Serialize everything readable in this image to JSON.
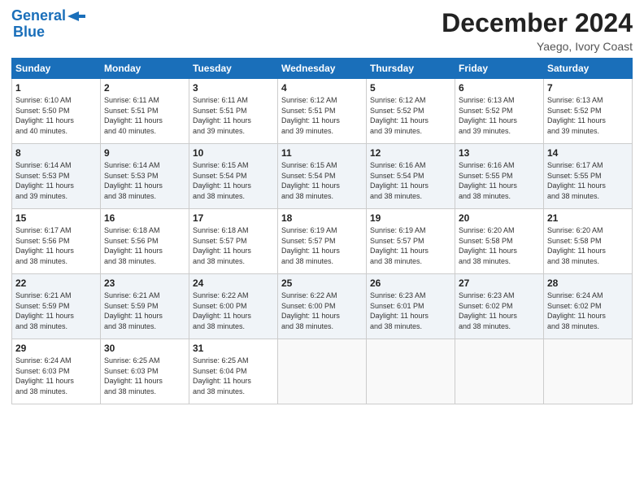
{
  "header": {
    "logo_line1": "General",
    "logo_line2": "Blue",
    "month": "December 2024",
    "location": "Yaego, Ivory Coast"
  },
  "weekdays": [
    "Sunday",
    "Monday",
    "Tuesday",
    "Wednesday",
    "Thursday",
    "Friday",
    "Saturday"
  ],
  "weeks": [
    [
      {
        "day": "1",
        "info": "Sunrise: 6:10 AM\nSunset: 5:50 PM\nDaylight: 11 hours\nand 40 minutes."
      },
      {
        "day": "2",
        "info": "Sunrise: 6:11 AM\nSunset: 5:51 PM\nDaylight: 11 hours\nand 40 minutes."
      },
      {
        "day": "3",
        "info": "Sunrise: 6:11 AM\nSunset: 5:51 PM\nDaylight: 11 hours\nand 39 minutes."
      },
      {
        "day": "4",
        "info": "Sunrise: 6:12 AM\nSunset: 5:51 PM\nDaylight: 11 hours\nand 39 minutes."
      },
      {
        "day": "5",
        "info": "Sunrise: 6:12 AM\nSunset: 5:52 PM\nDaylight: 11 hours\nand 39 minutes."
      },
      {
        "day": "6",
        "info": "Sunrise: 6:13 AM\nSunset: 5:52 PM\nDaylight: 11 hours\nand 39 minutes."
      },
      {
        "day": "7",
        "info": "Sunrise: 6:13 AM\nSunset: 5:52 PM\nDaylight: 11 hours\nand 39 minutes."
      }
    ],
    [
      {
        "day": "8",
        "info": "Sunrise: 6:14 AM\nSunset: 5:53 PM\nDaylight: 11 hours\nand 39 minutes."
      },
      {
        "day": "9",
        "info": "Sunrise: 6:14 AM\nSunset: 5:53 PM\nDaylight: 11 hours\nand 38 minutes."
      },
      {
        "day": "10",
        "info": "Sunrise: 6:15 AM\nSunset: 5:54 PM\nDaylight: 11 hours\nand 38 minutes."
      },
      {
        "day": "11",
        "info": "Sunrise: 6:15 AM\nSunset: 5:54 PM\nDaylight: 11 hours\nand 38 minutes."
      },
      {
        "day": "12",
        "info": "Sunrise: 6:16 AM\nSunset: 5:54 PM\nDaylight: 11 hours\nand 38 minutes."
      },
      {
        "day": "13",
        "info": "Sunrise: 6:16 AM\nSunset: 5:55 PM\nDaylight: 11 hours\nand 38 minutes."
      },
      {
        "day": "14",
        "info": "Sunrise: 6:17 AM\nSunset: 5:55 PM\nDaylight: 11 hours\nand 38 minutes."
      }
    ],
    [
      {
        "day": "15",
        "info": "Sunrise: 6:17 AM\nSunset: 5:56 PM\nDaylight: 11 hours\nand 38 minutes."
      },
      {
        "day": "16",
        "info": "Sunrise: 6:18 AM\nSunset: 5:56 PM\nDaylight: 11 hours\nand 38 minutes."
      },
      {
        "day": "17",
        "info": "Sunrise: 6:18 AM\nSunset: 5:57 PM\nDaylight: 11 hours\nand 38 minutes."
      },
      {
        "day": "18",
        "info": "Sunrise: 6:19 AM\nSunset: 5:57 PM\nDaylight: 11 hours\nand 38 minutes."
      },
      {
        "day": "19",
        "info": "Sunrise: 6:19 AM\nSunset: 5:57 PM\nDaylight: 11 hours\nand 38 minutes."
      },
      {
        "day": "20",
        "info": "Sunrise: 6:20 AM\nSunset: 5:58 PM\nDaylight: 11 hours\nand 38 minutes."
      },
      {
        "day": "21",
        "info": "Sunrise: 6:20 AM\nSunset: 5:58 PM\nDaylight: 11 hours\nand 38 minutes."
      }
    ],
    [
      {
        "day": "22",
        "info": "Sunrise: 6:21 AM\nSunset: 5:59 PM\nDaylight: 11 hours\nand 38 minutes."
      },
      {
        "day": "23",
        "info": "Sunrise: 6:21 AM\nSunset: 5:59 PM\nDaylight: 11 hours\nand 38 minutes."
      },
      {
        "day": "24",
        "info": "Sunrise: 6:22 AM\nSunset: 6:00 PM\nDaylight: 11 hours\nand 38 minutes."
      },
      {
        "day": "25",
        "info": "Sunrise: 6:22 AM\nSunset: 6:00 PM\nDaylight: 11 hours\nand 38 minutes."
      },
      {
        "day": "26",
        "info": "Sunrise: 6:23 AM\nSunset: 6:01 PM\nDaylight: 11 hours\nand 38 minutes."
      },
      {
        "day": "27",
        "info": "Sunrise: 6:23 AM\nSunset: 6:02 PM\nDaylight: 11 hours\nand 38 minutes."
      },
      {
        "day": "28",
        "info": "Sunrise: 6:24 AM\nSunset: 6:02 PM\nDaylight: 11 hours\nand 38 minutes."
      }
    ],
    [
      {
        "day": "29",
        "info": "Sunrise: 6:24 AM\nSunset: 6:03 PM\nDaylight: 11 hours\nand 38 minutes."
      },
      {
        "day": "30",
        "info": "Sunrise: 6:25 AM\nSunset: 6:03 PM\nDaylight: 11 hours\nand 38 minutes."
      },
      {
        "day": "31",
        "info": "Sunrise: 6:25 AM\nSunset: 6:04 PM\nDaylight: 11 hours\nand 38 minutes."
      },
      null,
      null,
      null,
      null
    ]
  ]
}
